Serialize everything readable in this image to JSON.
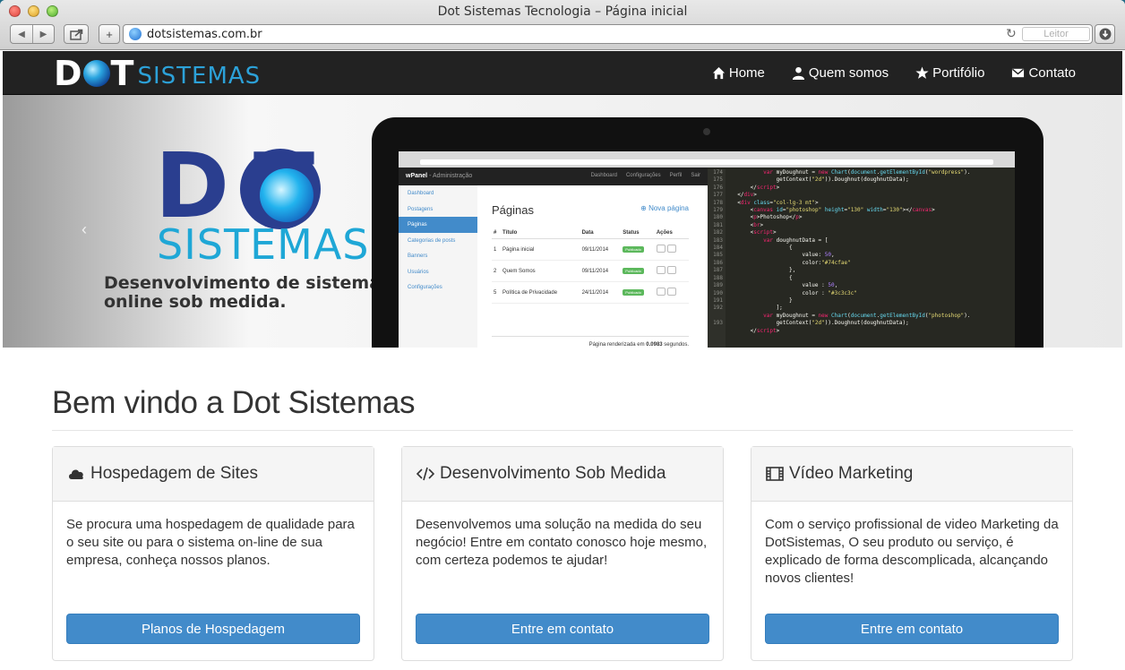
{
  "window": {
    "title": "Dot Sistemas Tecnologia – Página inicial"
  },
  "toolbar": {
    "url": "dotsistemas.com.br",
    "reader_label": "Leitor"
  },
  "site": {
    "logo": {
      "dot": "D",
      "dot_t": "T",
      "sistemas": "SISTEMAS"
    },
    "menu": [
      {
        "label": "Home",
        "icon": "home-icon"
      },
      {
        "label": "Quem somos",
        "icon": "user-icon"
      },
      {
        "label": "Portifólio",
        "icon": "star-icon"
      },
      {
        "label": "Contato",
        "icon": "envelope-icon"
      }
    ]
  },
  "hero": {
    "logo_dot": "D  T",
    "logo_sistemas": "SISTEMAS",
    "tagline_line1": "Desenvolvimento de sistemas",
    "tagline_line2": "online sob medida.",
    "admin": {
      "brand": "wPanel",
      "brand_sub": " - Administração",
      "menu": [
        "Dashboard",
        "Configurações",
        "Perfil",
        "Sair"
      ],
      "side": [
        "Dashboard",
        "Postagens",
        "Páginas",
        "Categorias de posts",
        "Banners",
        "Usuários",
        "Configurações"
      ],
      "title": "Páginas",
      "new_label": "Nova página",
      "columns": [
        "#",
        "Título",
        "Data",
        "Status",
        "Ações"
      ],
      "rows": [
        [
          "1",
          "Página inicial",
          "09/11/2014",
          "Publicado"
        ],
        [
          "2",
          "Quem Somos",
          "09/11/2014",
          "Publicado"
        ],
        [
          "5",
          "Política de Privacidade",
          "24/11/2014",
          "Publicado"
        ]
      ],
      "footer_prefix": "Página renderizada em ",
      "footer_time": "0.0983",
      "footer_suffix": " segundos."
    }
  },
  "content": {
    "heading": "Bem vindo a Dot Sistemas",
    "panels": [
      {
        "icon": "cloud-icon",
        "title": "Hospedagem de Sites",
        "text": "Se procura uma hospedagem de qualidade para o seu site ou para o sistema on-line de sua empresa, conheça nossos planos.",
        "button": "Planos de Hospedagem"
      },
      {
        "icon": "code-icon",
        "title": "Desenvolvimento Sob Medida",
        "text": "Desenvolvemos uma solução na medida do seu negócio! Entre em contato conosco hoje mesmo, com certeza podemos te ajudar!",
        "button": "Entre em contato"
      },
      {
        "icon": "film-icon",
        "title": "Vídeo Marketing",
        "text": "Com o serviço profissional de video Marketing da DotSistemas, O seu produto ou serviço, é explicado de forma descomplicada, alcançando novos clientes!",
        "button": "Entre em contato"
      }
    ]
  },
  "colors": {
    "navbar": "#222222",
    "accent": "#428bca",
    "logo_blue": "#2a3e8f",
    "logo_cyan": "#1fa7d6"
  }
}
